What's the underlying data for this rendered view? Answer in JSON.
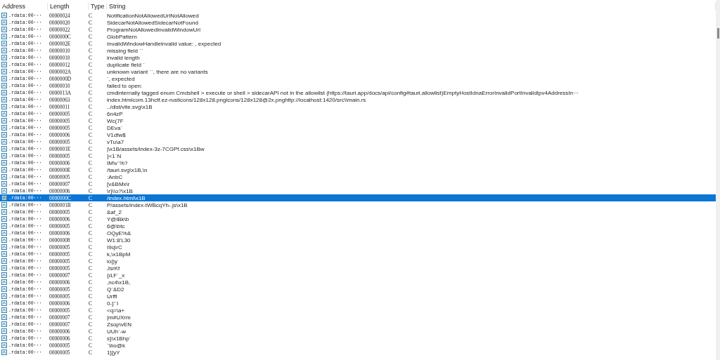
{
  "columns": [
    "Address",
    "Length",
    "Type",
    "String"
  ],
  "rows": [
    {
      "address": ".rdata:00···",
      "length": "00000024",
      "type": "C",
      "string": "NotificationNotAllowedUrlNotAllowed",
      "selected": false
    },
    {
      "address": ".rdata:00···",
      "length": "00000020",
      "type": "C",
      "string": "SidecarNotAllowedSidecarNotFound",
      "selected": false
    },
    {
      "address": ".rdata:00···",
      "length": "00000022",
      "type": "C",
      "string": "ProgramNotAllowedInvalidWindowUrl",
      "selected": false
    },
    {
      "address": ".rdata:00···",
      "length": "0000000C",
      "type": "C",
      "string": "GlobPattern",
      "selected": false
    },
    {
      "address": ".rdata:00···",
      "length": "0000002E",
      "type": "C",
      "string": "InvalidWindowHandleinvalid value: , expected",
      "selected": false
    },
    {
      "address": ".rdata:00···",
      "length": "00000010",
      "type": "C",
      "string": "missing field ``",
      "selected": false
    },
    {
      "address": ".rdata:00···",
      "length": "00000010",
      "type": "C",
      "string": "invalid length",
      "selected": false
    },
    {
      "address": ".rdata:00···",
      "length": "00000012",
      "type": "C",
      "string": "duplicate field `",
      "selected": false
    },
    {
      "address": ".rdata:00···",
      "length": "0000002A",
      "type": "C",
      "string": "unknown variant ``, there are no variants",
      "selected": false
    },
    {
      "address": ".rdata:00···",
      "length": "0000000D",
      "type": "C",
      "string": "`, expected",
      "selected": false
    },
    {
      "address": ".rdata:00···",
      "length": "00000010",
      "type": "C",
      "string": "failed to open:",
      "selected": false
    },
    {
      "address": ".rdata:00···",
      "length": "0000013A",
      "type": "C",
      "string": "cmdinternally tagged enum Cmdshell > execute or shell > sidecarAPI not in the allowlist (https://tauri.app/docs/api/config#tauri.allowlist)EmptyHostIdnaErrorInvalidPortInvalidIpv4AddressIn···",
      "selected": false
    },
    {
      "address": ".rdata:00···",
      "length": "00000063",
      "type": "C",
      "string": "index.htmlcom.13hctf.ez-rusticons/128x128.pngicons/128x128@2x.pnghttp://localhost:1420/src\\\\main.rs",
      "selected": false
    },
    {
      "address": ".rdata:00···",
      "length": "00000011",
      "type": "C",
      "string": "../dist/vite.svg\\x1B",
      "selected": false
    },
    {
      "address": ".rdata:00···",
      "length": "00000005",
      "type": "C",
      "string": "6n4zP",
      "selected": false
    },
    {
      "address": ".rdata:00···",
      "length": "00000005",
      "type": "C",
      "string": "Wc(7F",
      "selected": false
    },
    {
      "address": ".rdata:00···",
      "length": "00000005",
      "type": "C",
      "string": "DEva`",
      "selected": false
    },
    {
      "address": ".rdata:00···",
      "length": "00000006",
      "type": "C",
      "string": "V1dfw$",
      "selected": false
    },
    {
      "address": ".rdata:00···",
      "length": "00000005",
      "type": "C",
      "string": "vTu\\a7",
      "selected": false
    },
    {
      "address": ".rdata:00···",
      "length": "0000001E",
      "type": "C",
      "string": "|\\x1B/assets/index-3z-7CGPf.css\\x1Bw",
      "selected": false
    },
    {
      "address": ".rdata:00···",
      "length": "00000005",
      "type": "C",
      "string": "}<1`N",
      "selected": false
    },
    {
      "address": ".rdata:00···",
      "length": "00000006",
      "type": "C",
      "string": "IM\\v`%?",
      "selected": false
    },
    {
      "address": ".rdata:00···",
      "length": "0000000E",
      "type": "C",
      "string": "/tauri.svg\\x1B,\\n",
      "selected": false
    },
    {
      "address": ".rdata:00···",
      "length": "00000005",
      "type": "C",
      "string": ":AnbC",
      "selected": false
    },
    {
      "address": ".rdata:00···",
      "length": "00000007",
      "type": "C",
      "string": "[v&BMx\\r",
      "selected": false
    },
    {
      "address": ".rdata:00···",
      "length": "00000006",
      "type": "C",
      "string": "\\r}\\\\o?\\x1B",
      "selected": false
    },
    {
      "address": ".rdata:00···",
      "length": "0000000C",
      "type": "C",
      "string": "/index.html\\x1B",
      "selected": true
    },
    {
      "address": ".rdata:00···",
      "length": "0000001B",
      "type": "C",
      "string": "P/assets/index-tWBcqYh-.js\\x1B",
      "selected": false
    },
    {
      "address": ".rdata:00···",
      "length": "00000005",
      "type": "C",
      "string": "&af_2",
      "selected": false
    },
    {
      "address": ".rdata:00···",
      "length": "00000006",
      "type": "C",
      "string": "Y@lBk\\b",
      "selected": false
    },
    {
      "address": ".rdata:00···",
      "length": "00000005",
      "type": "C",
      "string": "6@\\btc",
      "selected": false
    },
    {
      "address": ".rdata:00···",
      "length": "00000006",
      "type": "C",
      "string": "OQyE%&",
      "selected": false
    },
    {
      "address": ".rdata:00···",
      "length": "00000008",
      "type": "C",
      "string": "W1:8'L30",
      "selected": false
    },
    {
      "address": ".rdata:00···",
      "length": "00000005",
      "type": "C",
      "string": "I9q\\rC",
      "selected": false
    },
    {
      "address": ".rdata:00···",
      "length": "00000005",
      "type": "C",
      "string": "k,\\x1BpM",
      "selected": false
    },
    {
      "address": ".rdata:00···",
      "length": "00000005",
      "type": "C",
      "string": "io|)y",
      "selected": false
    },
    {
      "address": ".rdata:00···",
      "length": "00000005",
      "type": "C",
      "string": "JsrKf",
      "selected": false
    },
    {
      "address": ".rdata:00···",
      "length": "00000007",
      "type": "C",
      "string": "{d,F`_x",
      "selected": false
    },
    {
      "address": ".rdata:00···",
      "length": "00000006",
      "type": "C",
      "string": ",nc4\\x1B,",
      "selected": false
    },
    {
      "address": ".rdata:00···",
      "length": "00000005",
      "type": "C",
      "string": "Q`&D2",
      "selected": false
    },
    {
      "address": ".rdata:00···",
      "length": "00000005",
      "type": "C",
      "string": "Urffl",
      "selected": false
    },
    {
      "address": ".rdata:00···",
      "length": "00000006",
      "type": "C",
      "string": "0-}'`I",
      "selected": false
    },
    {
      "address": ".rdata:00···",
      "length": "00000005",
      "type": "C",
      "string": "<q=\\a+",
      "selected": false
    },
    {
      "address": ".rdata:00···",
      "length": "00000007",
      "type": "C",
      "string": "|m#UXrm",
      "selected": false
    },
    {
      "address": ".rdata:00···",
      "length": "00000007",
      "type": "C",
      "string": "Zsop\\vEN",
      "selected": false
    },
    {
      "address": ".rdata:00···",
      "length": "00000006",
      "type": "C",
      "string": "UUh`-w",
      "selected": false
    },
    {
      "address": ".rdata:00···",
      "length": "00000006",
      "type": "C",
      "string": "s}\\x1Bhp`",
      "selected": false
    },
    {
      "address": ".rdata:00···",
      "length": "00000005",
      "type": "C",
      "string": "`\\bo@k",
      "selected": false
    },
    {
      "address": ".rdata:00···",
      "length": "00000005",
      "type": "C",
      "string": "1]{yY",
      "selected": false
    }
  ]
}
